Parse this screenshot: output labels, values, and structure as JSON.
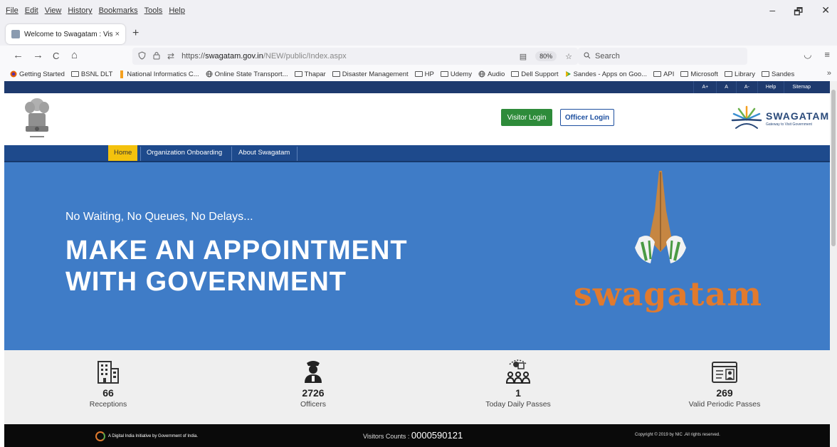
{
  "browser": {
    "menu": [
      "File",
      "Edit",
      "View",
      "History",
      "Bookmarks",
      "Tools",
      "Help"
    ],
    "window_controls": [
      "–",
      "🗗",
      "✕"
    ],
    "tab": {
      "title": "Welcome to Swagatam : Visitor",
      "close": "×"
    },
    "new_tab": "+",
    "nav": {
      "back": "←",
      "forward": "→",
      "reload": "C",
      "home": "⌂"
    },
    "url": {
      "scheme": "https://",
      "host": "swagatam.gov.in",
      "path": "/NEW/public/Index.aspx"
    },
    "zoom": "80%",
    "search_placeholder": "Search",
    "bookmarks": [
      {
        "label": "Getting Started",
        "icon": "firefox-icon"
      },
      {
        "label": "BSNL DLT",
        "icon": "folder-icon"
      },
      {
        "label": "National Informatics C...",
        "icon": "nic-icon"
      },
      {
        "label": "Online State Transport...",
        "icon": "globe-icon"
      },
      {
        "label": "Thapar",
        "icon": "folder-icon"
      },
      {
        "label": "Disaster Management",
        "icon": "folder-icon"
      },
      {
        "label": "HP",
        "icon": "folder-icon"
      },
      {
        "label": "Udemy",
        "icon": "folder-icon"
      },
      {
        "label": "Audio",
        "icon": "globe-icon"
      },
      {
        "label": "Dell Support",
        "icon": "folder-icon"
      },
      {
        "label": "Sandes - Apps on Goo...",
        "icon": "play-icon"
      },
      {
        "label": "API",
        "icon": "folder-icon"
      },
      {
        "label": "Microsoft",
        "icon": "folder-icon"
      },
      {
        "label": "Library",
        "icon": "folder-icon"
      },
      {
        "label": "Sandes",
        "icon": "folder-icon"
      }
    ],
    "bookmarks_more": "»"
  },
  "site": {
    "util_links": [
      "A+",
      "A",
      "A-",
      "Help",
      "Sitemap"
    ],
    "visitor_login": "Visitor Login",
    "officer_login": "Officer Login",
    "brand_name": "SWAGATAM",
    "brand_tagline": "Gateway to Visit Government",
    "nav": [
      "Home",
      "Organization Onboarding",
      "About Swagatam"
    ],
    "hero": {
      "tagline": "No Waiting, No Queues, No Delays...",
      "headline": "MAKE AN APPOINTMENT WITH GOVERNMENT",
      "logo_text": "swagatam"
    },
    "stats": [
      {
        "value": "66",
        "label": "Receptions",
        "icon": "building-icon"
      },
      {
        "value": "2726",
        "label": "Officers",
        "icon": "officer-icon"
      },
      {
        "value": "1",
        "label": "Today Daily Passes",
        "icon": "visitors-icon"
      },
      {
        "value": "269",
        "label": "Valid Periodic Passes",
        "icon": "id-card-icon"
      }
    ],
    "footer": {
      "digital_india": "A Digital India Initiative by Government of India.",
      "visitors_label": "Visitors Counts : ",
      "visitors_count": "0000590121",
      "copyright": "Copyright © 2019 by NIC .All rights reserved."
    }
  }
}
